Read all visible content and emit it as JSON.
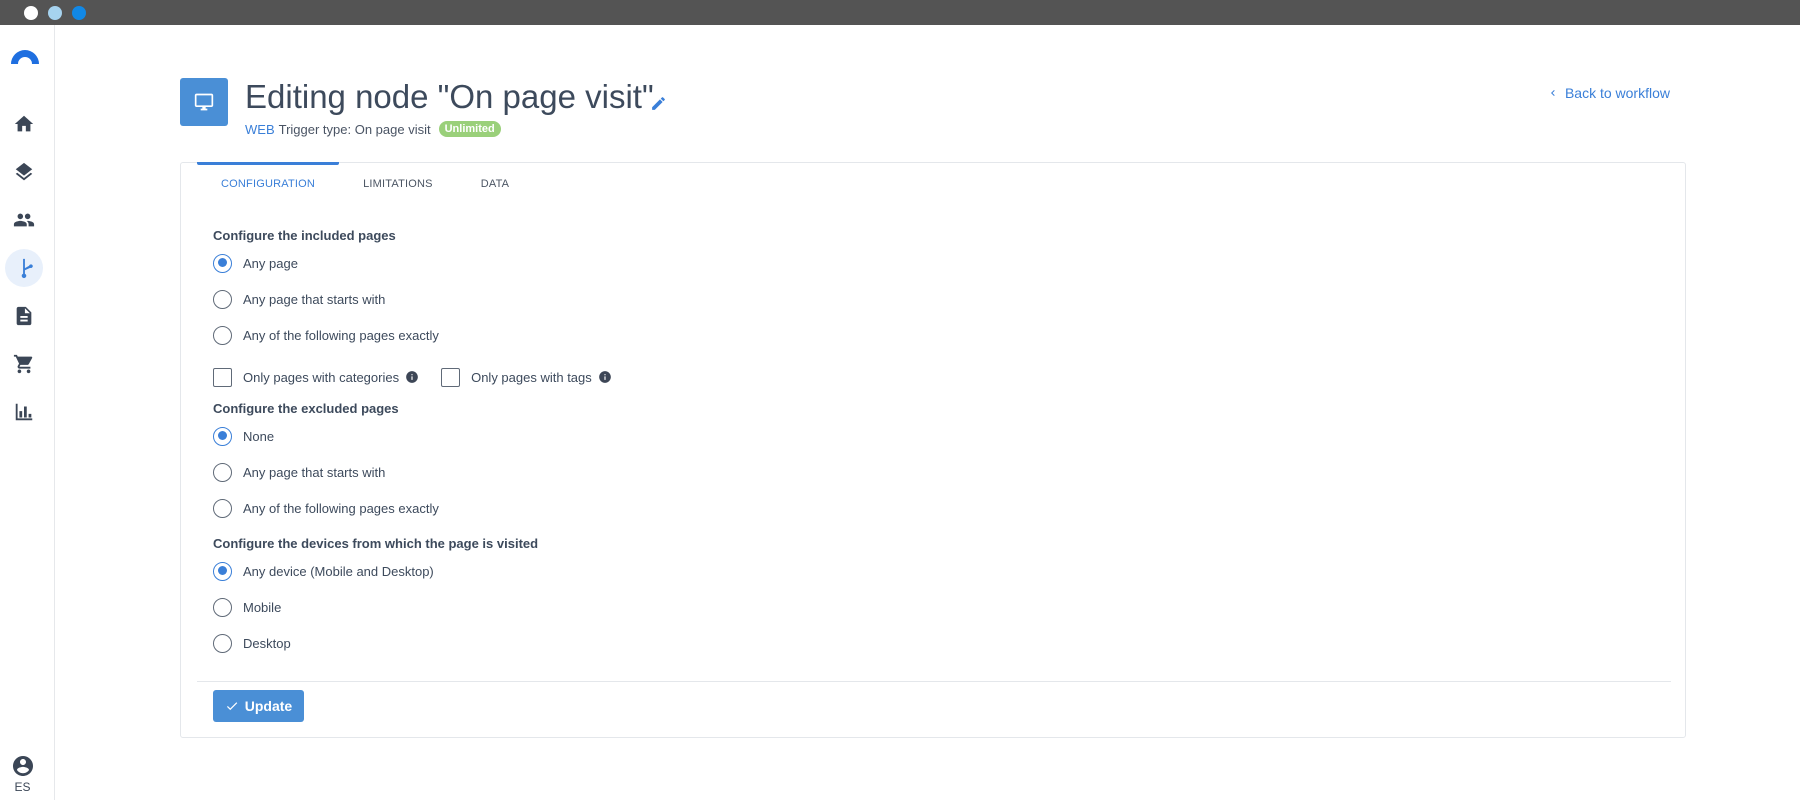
{
  "window": {
    "colors": {
      "bar": "#545454",
      "dot1": "#ffffff",
      "dot2": "#a6d3ef",
      "dot3": "#1188e6"
    }
  },
  "sidebar": {
    "items": [
      {
        "icon": "home-icon"
      },
      {
        "icon": "layers-icon"
      },
      {
        "icon": "people-icon"
      },
      {
        "icon": "workflow-icon",
        "active": true
      },
      {
        "icon": "document-icon"
      },
      {
        "icon": "cart-icon"
      },
      {
        "icon": "bar-chart-icon"
      }
    ],
    "user_label": "ES"
  },
  "header": {
    "title": "Editing node \"On page visit\"",
    "channel": "WEB",
    "trigger_text": "Trigger type: On page visit",
    "badge": "Unlimited",
    "back_link": "Back to workflow"
  },
  "tabs": [
    {
      "label": "CONFIGURATION",
      "active": true
    },
    {
      "label": "LIMITATIONS"
    },
    {
      "label": "DATA"
    }
  ],
  "included": {
    "label": "Configure the included pages",
    "options": [
      "Any page",
      "Any page that starts with",
      "Any of the following pages exactly"
    ],
    "selected": "Any page",
    "checks": [
      "Only pages with categories",
      "Only pages with tags"
    ]
  },
  "excluded": {
    "label": "Configure the excluded pages",
    "options": [
      "None",
      "Any page that starts with",
      "Any of the following pages exactly"
    ],
    "selected": "None"
  },
  "devices": {
    "label": "Configure the devices from which the page is visited",
    "options": [
      "Any device (Mobile and Desktop)",
      "Mobile",
      "Desktop"
    ],
    "selected": "Any device (Mobile and Desktop)"
  },
  "update_label": "Update",
  "colors": {
    "accent": "#3a7fd8",
    "button": "#4a8fd6",
    "badge": "#9ad07a"
  }
}
